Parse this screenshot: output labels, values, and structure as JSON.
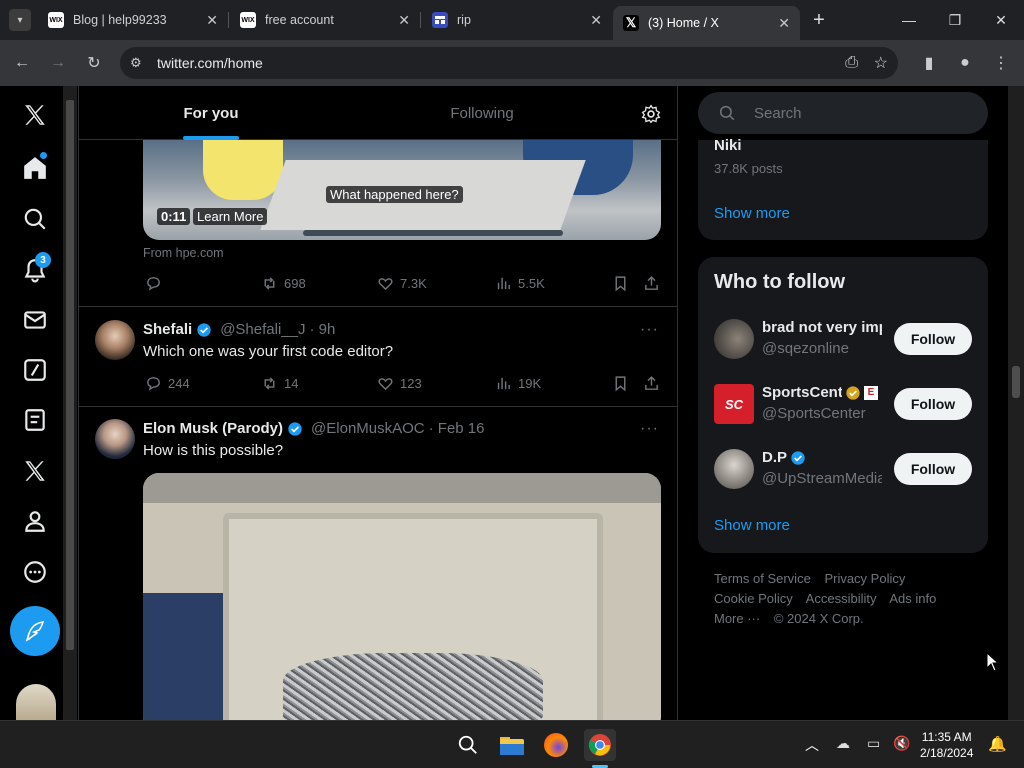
{
  "browser": {
    "tabs": [
      {
        "title": "Blog | help99233",
        "favicon": "WIX"
      },
      {
        "title": "free account",
        "favicon": "WIX"
      },
      {
        "title": "rip",
        "favicon": "rip-icon"
      },
      {
        "title": "(3) Home / X",
        "favicon": "X",
        "active": true
      }
    ],
    "url": "twitter.com/home"
  },
  "x_nav": {
    "notifications_badge": "3"
  },
  "feed": {
    "tabs": [
      "For you",
      "Following"
    ],
    "tweet1": {
      "overlay_caption": "What happened here?",
      "duration": "0:11",
      "learn_more": "Learn More",
      "source": "From hpe.com",
      "retweets": "698",
      "likes": "7.3K",
      "views": "5.5K"
    },
    "tweet2": {
      "name": "Shefali",
      "handle": "@Shefali__J",
      "time": "· 9h",
      "text": "Which one was your first code editor?",
      "replies": "244",
      "retweets": "14",
      "likes": "123",
      "views": "19K"
    },
    "tweet3": {
      "name": "Elon Musk (Parody)",
      "handle": "@ElonMuskAOC",
      "time": "· Feb 16",
      "text": "How is this possible?"
    }
  },
  "sidebar": {
    "search_placeholder": "Search",
    "trend": {
      "name": "Niki",
      "posts": "37.8K posts"
    },
    "show_more_1": "Show more",
    "who_to_follow_title": "Who to follow",
    "follow_items": [
      {
        "name": "brad not very imp",
        "handle": "@sqezonline",
        "button": "Follow"
      },
      {
        "name": "SportsCenter",
        "handle": "@SportsCenter",
        "button": "Follow"
      },
      {
        "name": "D.P",
        "handle": "@UpStreamMedia",
        "button": "Follow"
      }
    ],
    "show_more_2": "Show more",
    "footer": {
      "terms": "Terms of Service",
      "privacy": "Privacy Policy",
      "cookie": "Cookie Policy",
      "accessibility": "Accessibility",
      "ads": "Ads info",
      "more": "More ···",
      "copyright": "© 2024 X Corp."
    }
  },
  "taskbar": {
    "time": "11:35 AM",
    "date": "2/18/2024"
  },
  "colors": {
    "accent": "#1d9bf0",
    "background": "#000000",
    "panel": "#16181c",
    "muted": "#71767b"
  }
}
